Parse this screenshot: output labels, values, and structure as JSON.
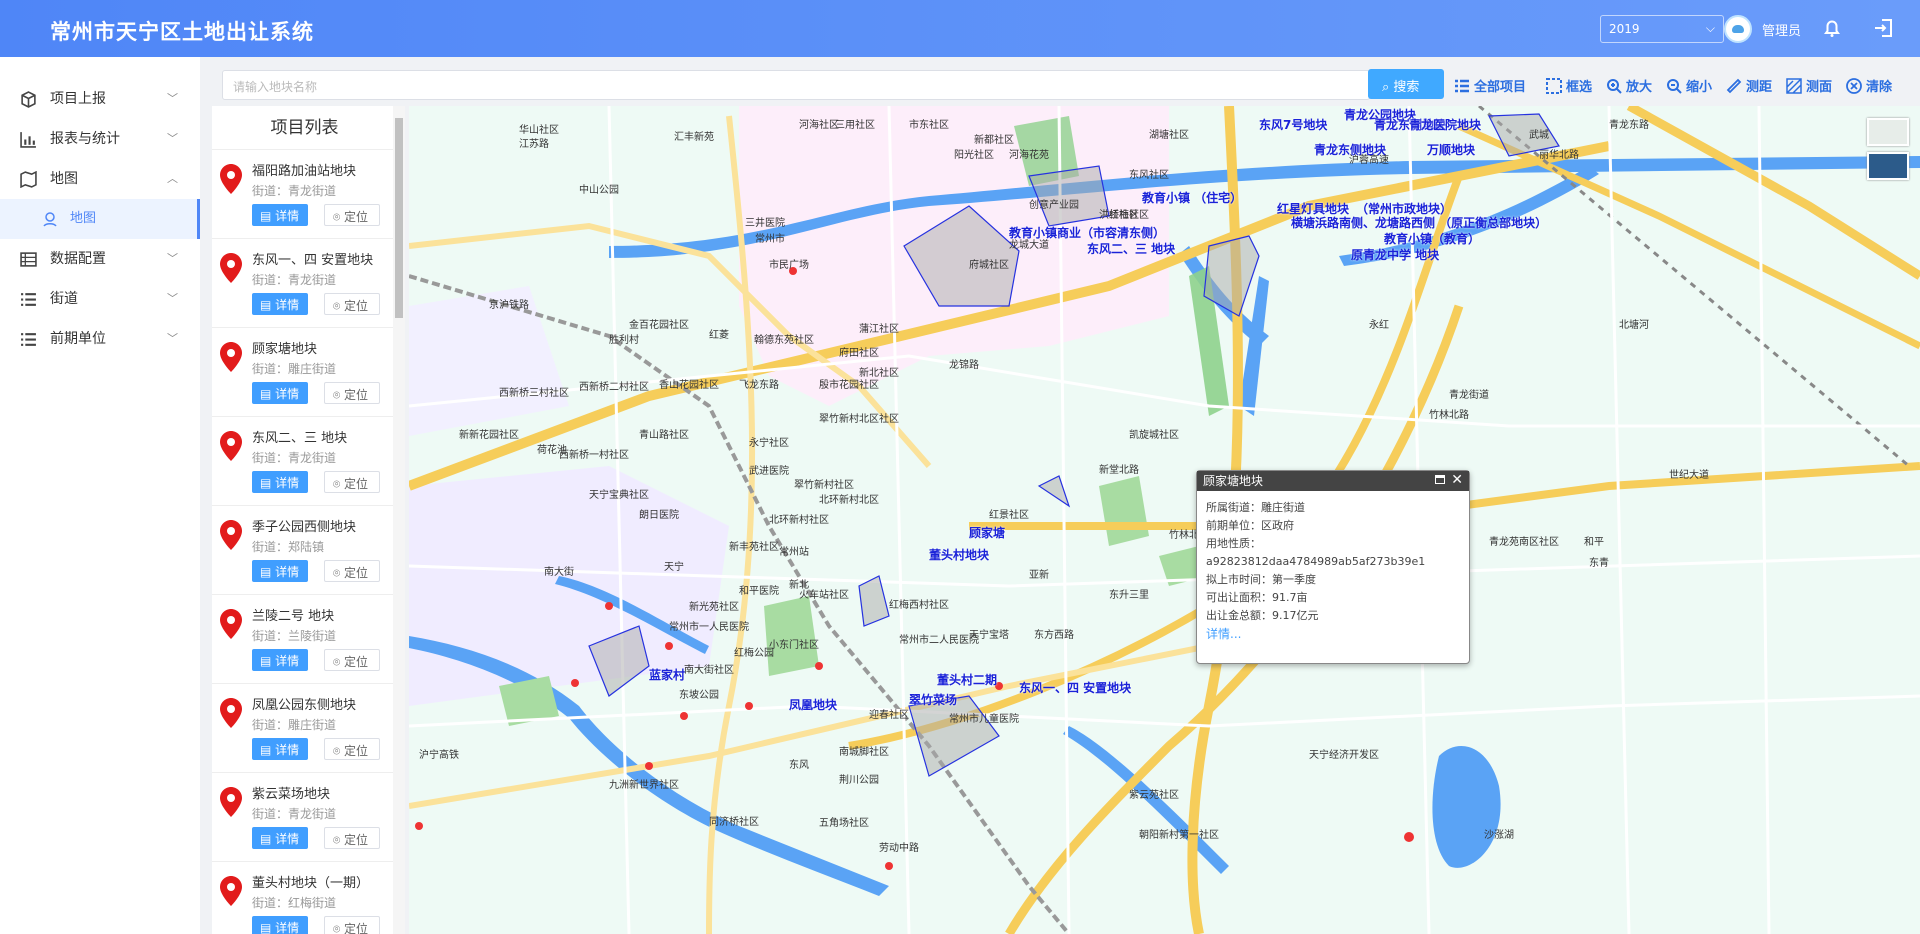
{
  "header": {
    "title": "常州市天宁区土地出让系统",
    "year": "2019",
    "user": "管理员"
  },
  "sidebar": {
    "items": [
      {
        "label": "项目上报",
        "icon": "cube-icon",
        "expanded": false
      },
      {
        "label": "报表与统计",
        "icon": "chart-icon",
        "expanded": false
      },
      {
        "label": "地图",
        "icon": "map-icon",
        "expanded": true
      },
      {
        "label": "地图",
        "icon": "location-icon",
        "sub": true,
        "active": true
      },
      {
        "label": "数据配置",
        "icon": "table-icon",
        "expanded": false
      },
      {
        "label": "街道",
        "icon": "list-icon",
        "expanded": false
      },
      {
        "label": "前期单位",
        "icon": "list-icon",
        "expanded": false
      }
    ]
  },
  "search": {
    "placeholder": "请输入地块名称",
    "button": "搜索"
  },
  "toolbar": {
    "all": "全部项目",
    "select": "框选",
    "zoom_in": "放大",
    "zoom_out": "缩小",
    "measure_dist": "测距",
    "measure_area": "测面",
    "clear": "清除"
  },
  "project_list": {
    "title": "项目列表",
    "detail_label": "详情",
    "locate_label": "定位",
    "items": [
      {
        "name": "福阳路加油站地块",
        "street": "街道：青龙街道"
      },
      {
        "name": "东风一、四 安置地块",
        "street": "街道：青龙街道"
      },
      {
        "name": "顾家塘地块",
        "street": "街道：雕庄街道"
      },
      {
        "name": "东风二、三 地块",
        "street": "街道：青龙街道"
      },
      {
        "name": "季子公园西侧地块",
        "street": "街道：郑陆镇"
      },
      {
        "name": "兰陵二号 地块",
        "street": "街道：兰陵街道"
      },
      {
        "name": "凤凰公园东侧地块",
        "street": "街道：雕庄街道"
      },
      {
        "name": "紫云菜场地块",
        "street": "街道：青龙街道"
      },
      {
        "name": "董头村地块（一期）",
        "street": "街道：红梅街道"
      }
    ]
  },
  "popup": {
    "title": "顾家塘地块",
    "lines": [
      "所属街道：雕庄街道",
      "前期单位：区政府",
      "用地性质：",
      "a92823812daa4784989ab5af273b39e1",
      "拟上市时间：第一季度",
      "可出让面积：91.7亩",
      "出让金总额：9.17亿元"
    ],
    "more": "详情..."
  },
  "map": {
    "parcel_labels": [
      "东风7号地块",
      "青龙公园地块",
      "青龙东侧地块",
      "青龙东侧地块",
      "青龙医院地块",
      "万顺地块",
      "教育小镇 （住宅）",
      "红星灯具地块",
      "（常州市政地块）",
      "横塘浜路南侧、龙塘路西侧 （原正衡总部地块）",
      "教育小镇商业（市容清东侧）",
      "东风二、三 地块",
      "教育小镇（教育）",
      "原青龙中学 地块",
      "顾家塘",
      "董头村地块",
      "蓝家村",
      "凤凰地块",
      "董头村二期",
      "东风一、四 安置地块",
      "翠竹菜场"
    ],
    "place_labels": [
      "华山社区",
      "汇丰新苑",
      "河海社区",
      "三用社区",
      "市东社区",
      "新都社区",
      "阳光社区",
      "河海花苑",
      "东风社区",
      "中山公园",
      "三井医院",
      "常州市",
      "市民广场",
      "红梅社区",
      "创意产业园",
      "洪桥社区",
      "府城社区",
      "湖塘社区",
      "金百花园社区",
      "胜利村",
      "红菱",
      "翰德东苑社区",
      "京沪铁路",
      "蒲江社区",
      "府田社区",
      "新北社区",
      "西新桥二村社区",
      "西新桥三村社区",
      "香山花园社区",
      "飞龙东路",
      "殷市花园社区",
      "翠竹新村北区社区",
      "永宁社区",
      "青山路社区",
      "新新花园社区",
      "西新桥一村社区",
      "武进医院",
      "翠竹新村社区",
      "北环新村北区",
      "荷花池",
      "天宁宝典社区",
      "朗日医院",
      "北环新村社区",
      "新丰苑社区",
      "常州站",
      "新北",
      "红梅西村社区",
      "火车站社区",
      "南大街",
      "天宁",
      "新光苑社区",
      "和平医院",
      "小东门社区",
      "常州市一人民医院",
      "南大街社区",
      "常州市二人民医院",
      "天宁宝塔",
      "红梅公园",
      "东坡公园",
      "迎春社区",
      "常州市儿童医院",
      "南城脚社区",
      "东风",
      "荆川公园",
      "五角场社区",
      "九洲新世界社区",
      "同济桥社区",
      "劳动中路",
      "朝阳新村第一社区",
      "紫云苑社区",
      "东方西路",
      "三里",
      "亚新",
      "红景社区",
      "凯旋城社区",
      "新堂北路",
      "青龙路北区社区",
      "竹林北路",
      "青龙苑南区社区",
      "和平",
      "东青",
      "东青社区",
      "天宁经济开发区",
      "沙涨湖",
      "东升",
      "青龙东路",
      "武城",
      "沪蓉高速",
      "北塘河",
      "青龙",
      "青龙街道",
      "丽华北路",
      "龙锦路",
      "龙城大道",
      "竹林北路",
      "世纪大道",
      "沪宁高铁",
      "永红",
      "江苏路"
    ]
  }
}
